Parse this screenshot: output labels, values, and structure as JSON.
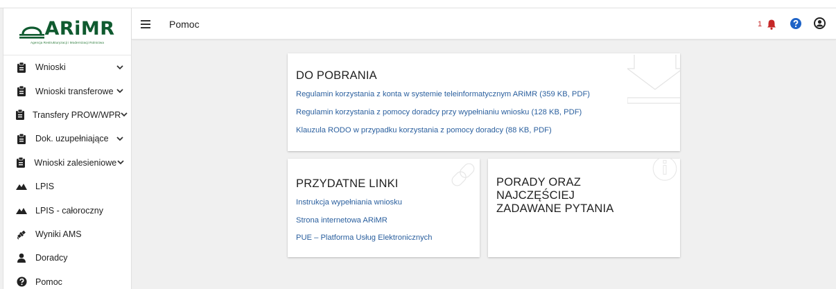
{
  "brand": {
    "name": "ARiMR",
    "subtitle": "Agencja Restrukturyzacji i Modernizacji Rolnictwa",
    "color": "#0f5a2f"
  },
  "sidebar": {
    "items": [
      {
        "label": "Wnioski",
        "icon": "clipboard-icon",
        "expandable": true
      },
      {
        "label": "Wnioski transferowe",
        "icon": "clipboard-icon",
        "expandable": true
      },
      {
        "label": "Transfery PROW/WPR",
        "icon": "clipboard-icon",
        "expandable": true
      },
      {
        "label": "Dok. uzupełniające",
        "icon": "clipboard-icon",
        "expandable": true
      },
      {
        "label": "Wnioski zalesieniowe",
        "icon": "clipboard-icon",
        "expandable": true
      },
      {
        "label": "LPIS",
        "icon": "mountains-icon",
        "expandable": false
      },
      {
        "label": "LPIS - całoroczny",
        "icon": "mountains-icon",
        "expandable": false
      },
      {
        "label": "Wyniki AMS",
        "icon": "satellite-icon",
        "expandable": false
      },
      {
        "label": "Doradcy",
        "icon": "user-icon",
        "expandable": false
      },
      {
        "label": "Pomoc",
        "icon": "question-circle-icon",
        "expandable": false
      }
    ]
  },
  "header": {
    "title": "Pomoc",
    "notification_count": "1",
    "notification_color": "#c62828",
    "help_color": "#1e63c7"
  },
  "cards": {
    "downloads": {
      "title": "DO POBRANIA",
      "links": [
        "Regulamin korzystania z konta w systemie teleinformatycznym ARiMR (359 KB, PDF)",
        "Regulamin korzystania z pomocy doradcy przy wypełnianiu wniosku (128 KB, PDF)",
        "Klauzula RODO w przypadku korzystania z pomocy doradcy (88 KB, PDF)"
      ]
    },
    "useful_links": {
      "title": "PRZYDATNE LINKI",
      "links": [
        "Instrukcja wypełniania wniosku",
        "Strona internetowa ARiMR",
        "PUE – Platforma Usług Elektronicznych"
      ]
    },
    "faq": {
      "title_lines": [
        "PORADY ORAZ",
        "NAJCZĘŚCIEJ",
        "ZADAWANE PYTANIA"
      ]
    }
  },
  "colors": {
    "link": "#2a5f9e",
    "background": "#f0f0f0"
  }
}
